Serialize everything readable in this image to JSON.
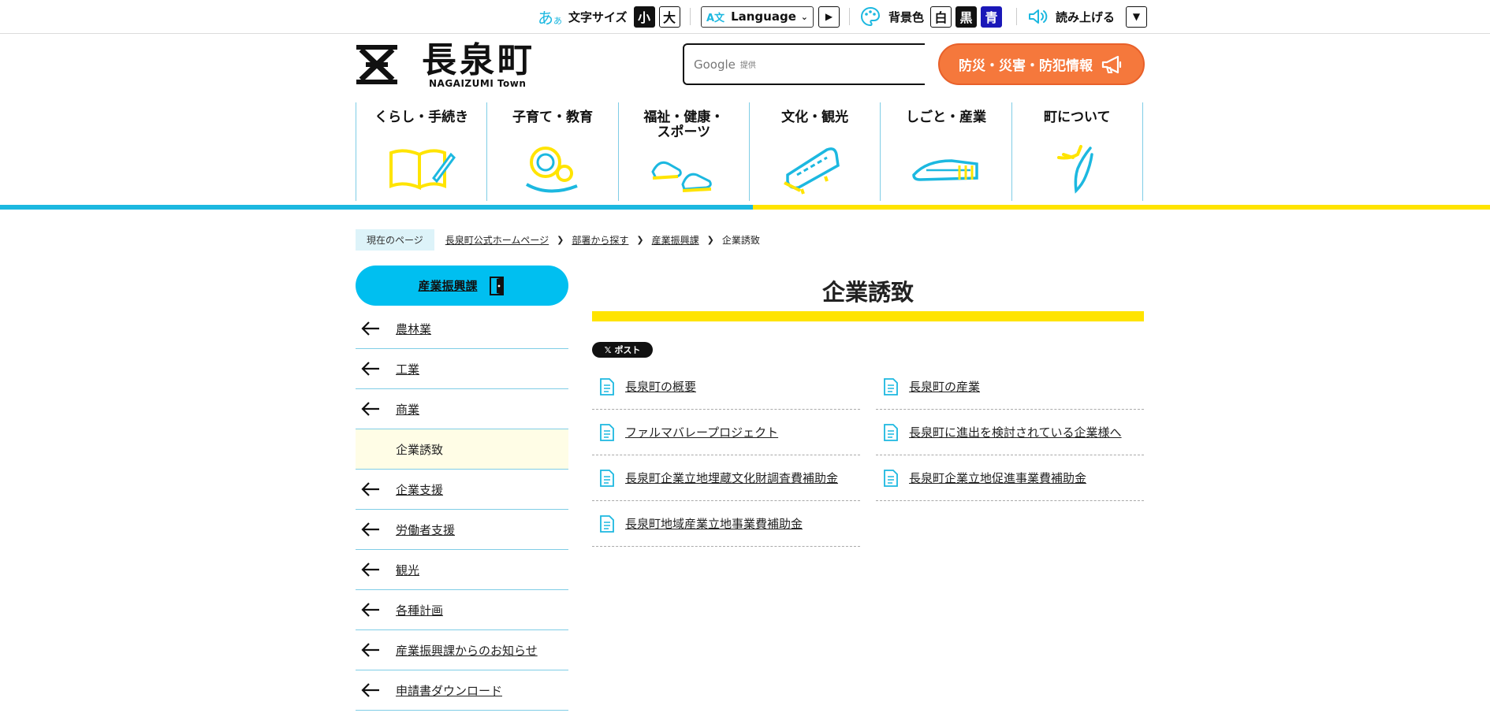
{
  "utility": {
    "font_size_label": "文字サイズ",
    "font_small": "小",
    "font_large": "大",
    "language_label": "Language",
    "bg_color_label": "背景色",
    "bg_white": "白",
    "bg_black": "黒",
    "bg_blue": "青",
    "read_aloud_label": "読み上げる"
  },
  "header": {
    "logo_text": "長泉町",
    "logo_sub": "NAGAIZUMI Town",
    "search_brand": "Google",
    "search_provided": "提供",
    "disaster_button": "防災・災害・防犯情報"
  },
  "gnav": [
    {
      "label": "くらし・手続き",
      "icon": "book-pen-icon"
    },
    {
      "label": "子育て・教育",
      "icon": "parent-child-icon"
    },
    {
      "label": "福祉・健康・\nスポーツ",
      "icon": "sneakers-icon"
    },
    {
      "label": "文化・観光",
      "icon": "tour-bus-icon"
    },
    {
      "label": "しごと・産業",
      "icon": "bullet-train-icon"
    },
    {
      "label": "町について",
      "icon": "town-map-icon"
    }
  ],
  "breadcrumb": {
    "current_label": "現在のページ",
    "items": [
      "長泉町公式ホームページ",
      "部署から探す",
      "産業振興課",
      "企業誘致"
    ]
  },
  "sidebar": {
    "heading": "産業振興課",
    "items": [
      {
        "label": "農林業",
        "active": false
      },
      {
        "label": "工業",
        "active": false
      },
      {
        "label": "商業",
        "active": false
      },
      {
        "label": "企業誘致",
        "active": true
      },
      {
        "label": "企業支援",
        "active": false
      },
      {
        "label": "労働者支援",
        "active": false
      },
      {
        "label": "観光",
        "active": false
      },
      {
        "label": "各種計画",
        "active": false
      },
      {
        "label": "産業振興課からのお知らせ",
        "active": false
      },
      {
        "label": "申請書ダウンロード",
        "active": false
      }
    ]
  },
  "main": {
    "title": "企業誘致",
    "x_post_label": "ポスト",
    "links": [
      "長泉町の概要",
      "長泉町の産業",
      "ファルマバレープロジェクト",
      "長泉町に進出を検討されている企業様へ",
      "長泉町企業立地埋蔵文化財調査費補助金",
      "長泉町企業立地促進事業費補助金",
      "長泉町地域産業立地事業費補助金"
    ]
  },
  "colors": {
    "accent_blue": "#00bff0",
    "accent_yellow": "#ffe400",
    "disaster_orange": "#f5783c",
    "bg_blue_button": "#1a17b8"
  }
}
